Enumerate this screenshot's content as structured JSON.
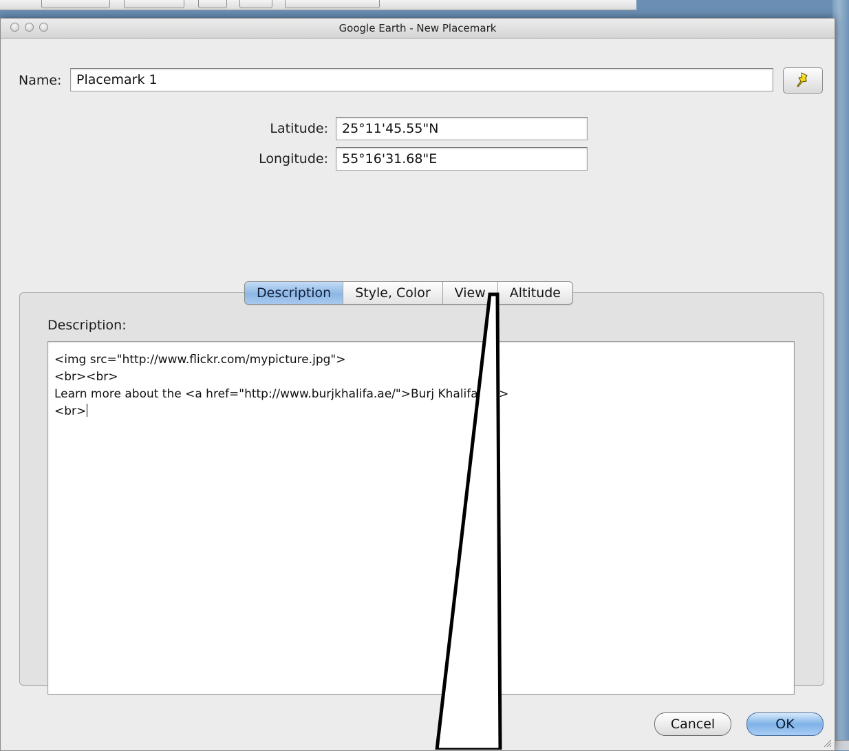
{
  "window": {
    "title": "Google Earth - New Placemark"
  },
  "name_field": {
    "label": "Name:",
    "value": "Placemark 1",
    "pin_icon": "yellow-pushpin-icon"
  },
  "coordinates": {
    "latitude_label": "Latitude:",
    "latitude_value": "25°11'45.55\"N",
    "longitude_label": "Longitude:",
    "longitude_value": "55°16'31.68\"E"
  },
  "tabs": [
    {
      "label": "Description",
      "active": true
    },
    {
      "label": "Style, Color",
      "active": false
    },
    {
      "label": "View",
      "active": false
    },
    {
      "label": "Altitude",
      "active": false
    }
  ],
  "description": {
    "label": "Description:",
    "lines": [
      "<img src=\"http://www.flickr.com/mypicture.jpg\">",
      "<br><br>",
      "Learn more about the <a href=\"http://www.burjkhalifa.ae/\">Burj Khalifa</a>",
      "<br>"
    ]
  },
  "buttons": {
    "cancel": "Cancel",
    "ok": "OK"
  },
  "colors": {
    "accent_blue": "#8db7e5",
    "window_bg": "#ececec"
  }
}
